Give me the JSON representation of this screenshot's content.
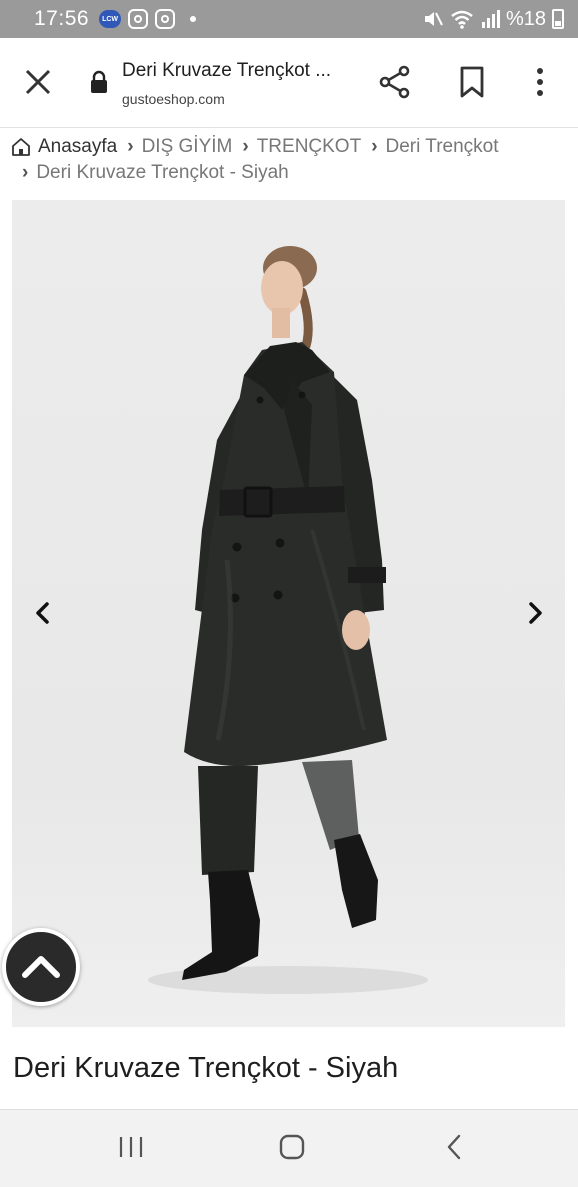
{
  "status_bar": {
    "time": "17:56",
    "app_badge": "LCW",
    "battery": "%18"
  },
  "url_bar": {
    "page_title": "Deri Kruvaze Trençkot ...",
    "domain": "gustoeshop.com"
  },
  "breadcrumb": {
    "home": "Anasayfa",
    "items": [
      "DIŞ GİYİM",
      "TRENÇKOT",
      "Deri Trençkot"
    ],
    "current": "Deri Kruvaze Trençkot - Siyah"
  },
  "product": {
    "title": "Deri Kruvaze Trençkot - Siyah"
  },
  "icons": {
    "close": "close-icon",
    "lock": "lock-icon",
    "share": "share-icon",
    "bookmark": "bookmark-icon",
    "menu": "more-vert-icon",
    "home": "home-icon",
    "prev": "chevron-left-icon",
    "next": "chevron-right-icon",
    "scroll_top": "chevron-up-icon"
  },
  "colors": {
    "status_bar": "#9a9a9a",
    "badge": "#2f58b8",
    "scroll_top_button": "#2a2a2a",
    "nav_bar": "#f2f2f2"
  }
}
